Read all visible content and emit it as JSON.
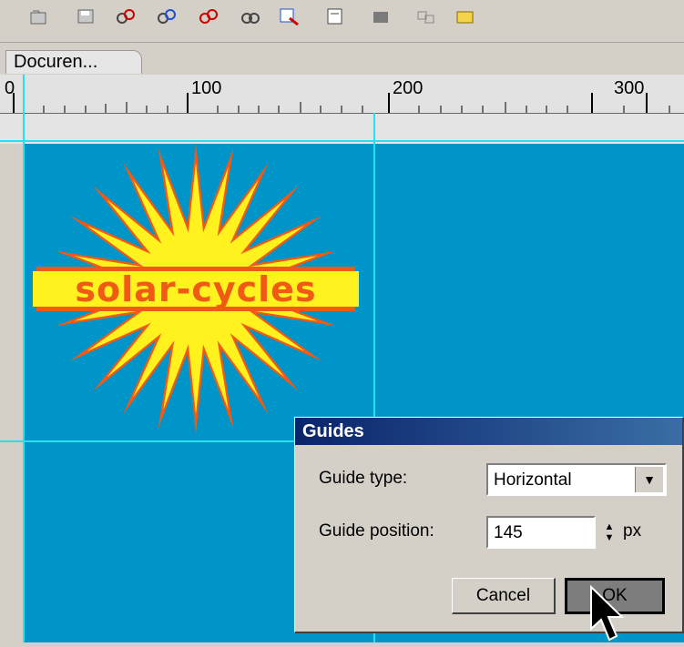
{
  "toolbar": {
    "icons": [
      "open-icon",
      "save-icon",
      "link-icon",
      "unlink-icon",
      "break-link-icon",
      "chain-icon",
      "zoom-doc-icon",
      "doc-icon",
      "gray-box-icon",
      "group-icon",
      "folder-icon"
    ]
  },
  "document_tab": {
    "label": "Docuren..."
  },
  "ruler": {
    "labels": [
      "0",
      "100",
      "200",
      "300"
    ]
  },
  "logo": {
    "text": "solar-cycles"
  },
  "dialog": {
    "title": "Guides",
    "guide_type_label": "Guide type:",
    "guide_type_value": "Horizontal",
    "guide_position_label": "Guide position:",
    "guide_position_value": "145",
    "unit": "px",
    "cancel_label": "Cancel",
    "ok_label": "OK"
  },
  "colors": {
    "artboard": "#0095c8",
    "guide": "#25e2f2",
    "sun_outer": "#f05a14",
    "sun_inner": "#fff21e",
    "dialog_title": "#0a246a"
  }
}
